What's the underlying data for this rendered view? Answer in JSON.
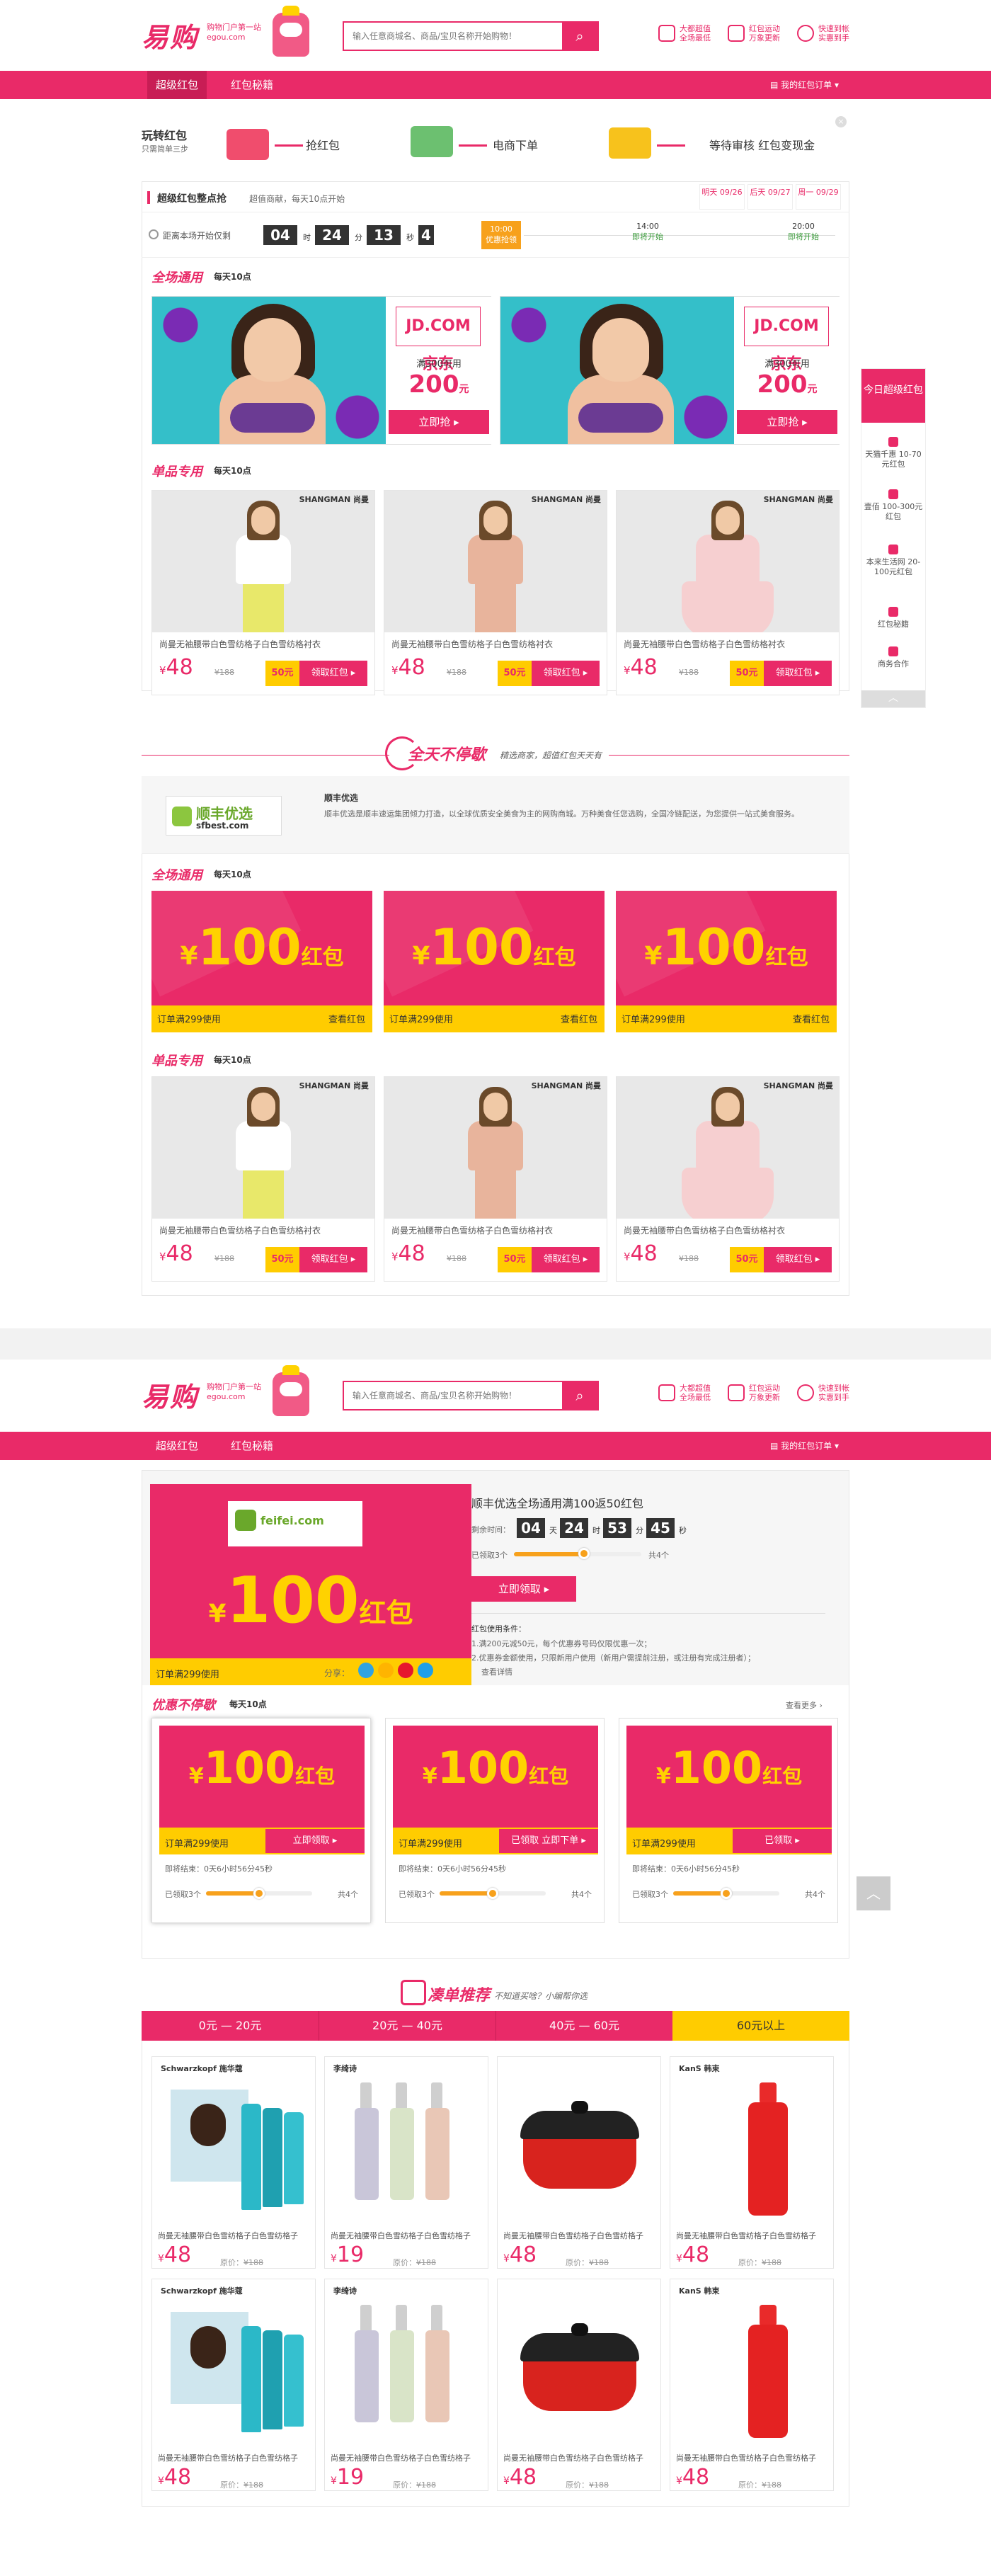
{
  "header": {
    "logo": "易购",
    "logo_sub1": "购物门户第一站",
    "logo_sub2": "egou.com",
    "search_placeholder": "输入任意商城名、商品/宝贝名称开始购物！",
    "links": [
      {
        "icon": "rebate-icon",
        "line1": "大都超值",
        "line2": "全场最低"
      },
      {
        "icon": "gift-icon",
        "line1": "红包运动",
        "line2": "万象更新"
      },
      {
        "icon": "return-icon",
        "line1": "快速到帐",
        "line2": "实惠到手"
      }
    ]
  },
  "nav": {
    "items": [
      "超级红包",
      "红包秘籍"
    ],
    "right": "我的红包订单"
  },
  "steps": {
    "title": "玩转红包",
    "subtitle": "只需简单三步",
    "s1": "抢红包",
    "s2": "电商下单",
    "s3": "等待审核 红包变现金"
  },
  "session": {
    "title": "超级红包整点抢",
    "subtitle": "超值商献，每天10点开始",
    "dates": [
      "明天 09/26",
      "后天 09/27",
      "周一 09/29"
    ],
    "countdown_label": "距离本场开始仅剩",
    "countdown": [
      "04",
      "24",
      "13",
      "4"
    ],
    "units": [
      "时",
      "分",
      "秒"
    ],
    "slots": [
      {
        "time": "10:00",
        "status": "优惠抢领"
      },
      {
        "time": "14:00",
        "status": "即将开始"
      },
      {
        "time": "20:00",
        "status": "即将开始"
      }
    ]
  },
  "sec1": {
    "title": "全场通用",
    "sub": "每天10点",
    "coupons": [
      {
        "logo": "JD.COM 京东",
        "min": "满300可用",
        "amount": "200",
        "unit": "元",
        "btn": "立即抢"
      },
      {
        "logo": "JD.COM 京东",
        "min": "满300可用",
        "amount": "200",
        "unit": "元",
        "btn": "立即抢"
      }
    ]
  },
  "sec2": {
    "title": "单品专用",
    "sub": "每天10点",
    "products": [
      {
        "brand": "SHANGMAN 尚曼",
        "name": "尚曼无袖腰带白色雪纺格子白色雪纺格衬衣",
        "price": "48",
        "old": "¥188",
        "badge": "50元",
        "btn": "领取红包"
      },
      {
        "brand": "SHANGMAN 尚曼",
        "name": "尚曼无袖腰带白色雪纺格子白色雪纺格衬衣",
        "price": "48",
        "old": "¥188",
        "badge": "50元",
        "btn": "领取红包"
      },
      {
        "brand": "SHANGMAN 尚曼",
        "name": "尚曼无袖腰带白色雪纺格子白色雪纺格衬衣",
        "price": "48",
        "old": "¥188",
        "badge": "50元",
        "btn": "领取红包"
      }
    ]
  },
  "divider": {
    "title": "全天不停歇",
    "sub": "精选商家，超值红包天天有"
  },
  "merchant": {
    "logo": "顺丰优选",
    "url": "sfbest.com",
    "name": "顺丰优选",
    "desc": "顺丰优选是顺丰速运集团倾力打造，以全球优质安全美食为主的网购商城。万种美食任您选购，全国冷链配送，为您提供一站式美食服务。"
  },
  "sec3": {
    "title": "全场通用",
    "sub": "每天10点",
    "coupons": [
      {
        "amount": "100",
        "word": "红包",
        "cond": "订单满299使用",
        "link": "查看红包"
      },
      {
        "amount": "100",
        "word": "红包",
        "cond": "订单满299使用",
        "link": "查看红包"
      },
      {
        "amount": "100",
        "word": "红包",
        "cond": "订单满299使用",
        "link": "查看红包"
      }
    ]
  },
  "sec4": {
    "title": "单品专用",
    "sub": "每天10点"
  },
  "detail": {
    "logo": "feifei.com",
    "amount": "100",
    "word": "红包",
    "cond": "订单满299使用",
    "share": "分享：",
    "title": "顺丰优选全场通用满100返50红包",
    "countdown_label": "剩余时间：",
    "countdown": [
      "04",
      "24",
      "53",
      "45"
    ],
    "taken": "已领取3个",
    "total": "共4个",
    "progress": 0.55,
    "btn": "立即领取",
    "rules_title": "红包使用条件：",
    "rules": [
      "1.满200元减50元，每个优惠券号码仅限优惠一次；",
      "2.优惠券金额使用，只限新用户使用（新用户需提前注册，或注册有完成注册者）；",
      "查看详情"
    ]
  },
  "hot": {
    "title": "优惠不停歇",
    "sub": "每天10点",
    "more": "查看更多",
    "cards": [
      {
        "amount": "100",
        "word": "红包",
        "cond": "订单满299使用",
        "btn": "立即领取",
        "countdown": "即将结束：0天6小时56分45秒",
        "taken": "已领取3个",
        "total": "共4个",
        "progress": 0.5
      },
      {
        "amount": "100",
        "word": "红包",
        "cond": "订单满299使用",
        "btn": "已领取 立即下单",
        "countdown": "即将结束：0天6小时56分45秒",
        "taken": "已领取3个",
        "total": "共4个",
        "progress": 0.5
      },
      {
        "amount": "100",
        "word": "红包",
        "cond": "订单满299使用",
        "btn": "已领取",
        "countdown": "即将结束：0天6小时56分45秒",
        "taken": "已领取3个",
        "total": "共4个",
        "progress": 0.5
      }
    ]
  },
  "rec": {
    "title": "凑单推荐",
    "sub": "不知道买啥？小编帮你选",
    "tabs": [
      "0元 — 20元",
      "20元 — 40元",
      "40元 — 60元",
      "60元以上"
    ],
    "products": [
      {
        "brand": "Schwarzkopf 施华蔻",
        "name": "尚曼无袖腰带白色雪纺格子白色雪纺格子",
        "price": "48",
        "old": "¥188"
      },
      {
        "brand": "李绮诗",
        "name": "尚曼无袖腰带白色雪纺格子白色雪纺格子",
        "price": "19",
        "old": "¥188"
      },
      {
        "brand": "",
        "name": "尚曼无袖腰带白色雪纺格子白色雪纺格子",
        "price": "48",
        "old": "¥188"
      },
      {
        "brand": "KanS 韩束",
        "name": "尚曼无袖腰带白色雪纺格子白色雪纺格子",
        "price": "48",
        "old": "¥188"
      },
      {
        "brand": "Schwarzkopf 施华蔻",
        "name": "尚曼无袖腰带白色雪纺格子白色雪纺格子",
        "price": "48",
        "old": "¥188"
      },
      {
        "brand": "李绮诗",
        "name": "尚曼无袖腰带白色雪纺格子白色雪纺格子",
        "price": "19",
        "old": "¥188"
      },
      {
        "brand": "",
        "name": "尚曼无袖腰带白色雪纺格子白色雪纺格子",
        "price": "48",
        "old": "¥188"
      },
      {
        "brand": "KanS 韩束",
        "name": "尚曼无袖腰带白色雪纺格子白色雪纺格子",
        "price": "48",
        "old": "¥188"
      }
    ]
  },
  "sidebar": {
    "title": "今日超级红包",
    "items": [
      "天猫千惠 10-70元红包",
      "壹佰 100-300元红包",
      "本来生活网 20-100元红包",
      "红包秘籍",
      "商务合作"
    ]
  },
  "colors": {
    "accent": "#e92a68",
    "yellow": "#ffcc00"
  }
}
